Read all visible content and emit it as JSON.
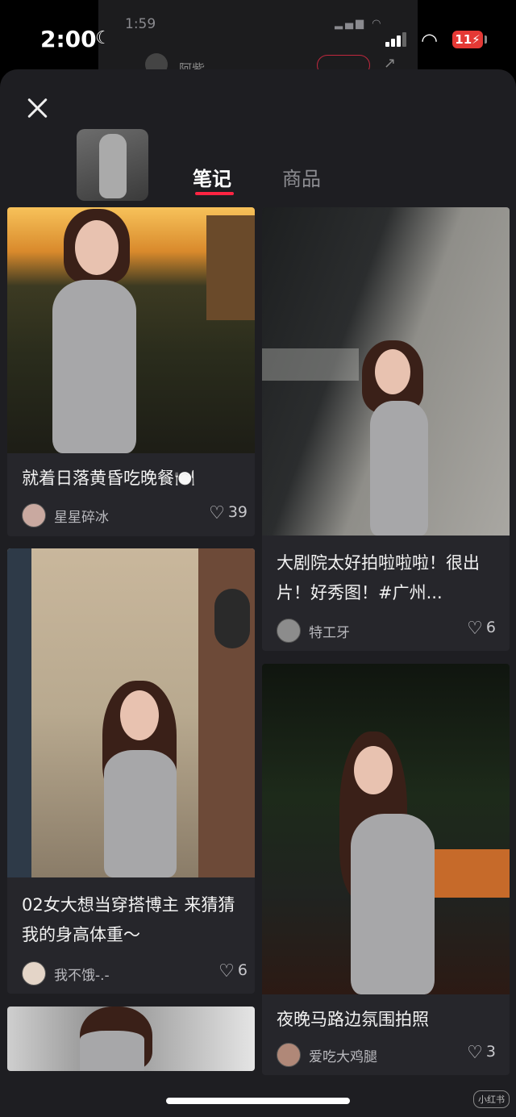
{
  "underlay": {
    "time": "1:59",
    "name": "阿紫"
  },
  "status": {
    "time": "2:00",
    "battery": "11"
  },
  "tabs": [
    {
      "label": "笔记",
      "active": true
    },
    {
      "label": "商品",
      "active": false
    }
  ],
  "cards": [
    {
      "title": "就着日落黄昏吃晚餐🍽️",
      "author": "星星碎冰",
      "likes": "39"
    },
    {
      "title": "大剧院太好拍啦啦啦！很出片！好秀图！#广州...",
      "author": "特工牙",
      "likes": "6"
    },
    {
      "title": "02女大想当穿搭博主 来猜猜我的身高体重～",
      "author": "我不饿-.-",
      "likes": "6"
    },
    {
      "title": "夜晚马路边氛围拍照",
      "author": "爱吃大鸡腿",
      "likes": "3"
    }
  ],
  "watermark": "小红书",
  "colors": {
    "accent": "#ff2442",
    "sheet": "#1e1e22",
    "card": "#26262b"
  },
  "icons": [
    "close-icon",
    "heart-icon",
    "wifi-icon",
    "moon-icon",
    "signal-icon",
    "battery-icon"
  ]
}
